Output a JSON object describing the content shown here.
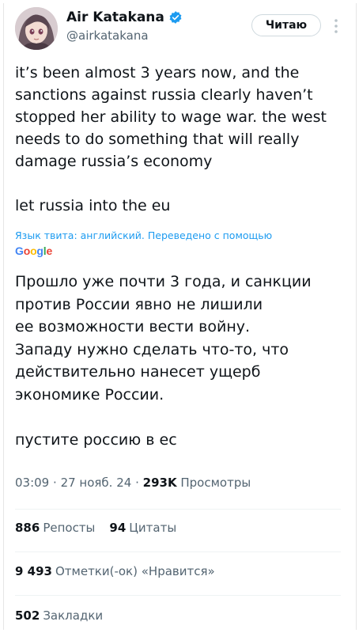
{
  "author": {
    "display_name": "Air Katakana",
    "handle": "@airkatakana",
    "avatar": "avatar-illustration",
    "verified_icon": "verified-badge-icon"
  },
  "header": {
    "follow_label": "Читаю",
    "more_icon": "more-options-icon"
  },
  "tweet": {
    "text": "it’s been almost 3 years now, and the\nsanctions against russia clearly haven’t\nstopped her ability to wage war. the west\nneeds to do something that will really\ndamage russia’s economy\n\nlet russia into the eu",
    "translation_label": "Язык твита: английский. Переведено с помощью",
    "translator_logo": "Google",
    "translated_text": "Прошло уже почти 3 года, и санкции\nпротив России явно не лишили\nее возможности вести войну.\nЗападу нужно сделать что-то, что\nдействительно нанесет ущерб\nэкономике России.\n\nпустите россию в ес"
  },
  "meta": {
    "time": "03:09",
    "date": "27 нояб. 24",
    "views_count": "293K",
    "views_label": "Просмотры"
  },
  "stats": {
    "reposts_count": "886",
    "reposts_label": "Репосты",
    "quotes_count": "94",
    "quotes_label": "Цитаты",
    "likes_count": "9 493",
    "likes_label": "Отметки(-ок) «Нравится»",
    "bookmarks_count": "502",
    "bookmarks_label": "Закладки"
  },
  "colors": {
    "accent": "#1d9bf0",
    "text": "#0f1419",
    "secondary": "#536471"
  }
}
